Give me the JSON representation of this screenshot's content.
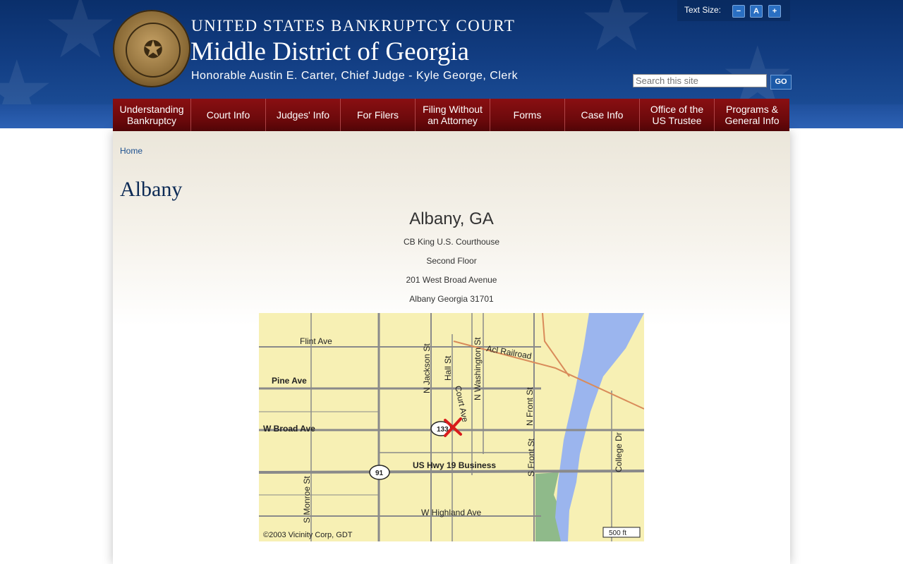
{
  "header": {
    "court_name": "UNITED STATES BANKRUPTCY COURT",
    "district": "Middle District of Georgia",
    "judges": "Honorable Austin E. Carter, Chief Judge - Kyle George, Clerk",
    "seal_icon": "seal-emblem"
  },
  "text_size": {
    "label": "Text Size:",
    "decrease": "−",
    "reset": "A",
    "increase": "+"
  },
  "search": {
    "placeholder": "Search this site",
    "go_label": "GO"
  },
  "nav": [
    "Understanding\nBankruptcy",
    "Court Info",
    "Judges' Info",
    "For Filers",
    "Filing Without\nan Attorney",
    "Forms",
    "Case Info",
    "Office of the\nUS Trustee",
    "Programs &\nGeneral Info"
  ],
  "breadcrumb": {
    "home": "Home"
  },
  "page": {
    "title": "Albany",
    "location_title": "Albany, GA",
    "address_lines": [
      "CB King U.S. Courthouse",
      "Second Floor",
      "201 West Broad Avenue",
      "Albany Georgia 31701"
    ]
  },
  "map": {
    "labels": {
      "flint": "Flint Ave",
      "pine": "Pine Ave",
      "broad": "W Broad Ave",
      "hwy19": "US Hwy 19 Business",
      "highland": "W Highland Ave",
      "jackson": "N Jackson St",
      "hall": "Hall St",
      "washington": "N Washington St",
      "railroad": "Acl Railroad",
      "court": "Court Ave",
      "nfront": "N Front St",
      "sfront": "S Front St",
      "college": "College Dr",
      "monroe": "S Monroe St",
      "route133": "133",
      "route91": "91",
      "copyright": "©2003 Vicinity Corp, GDT",
      "scale": "500 ft"
    },
    "colors": {
      "land": "#f7f0b4",
      "river": "#9bb5ee",
      "park": "#8fba8a",
      "road": "#8a8a8a",
      "rail": "#d98b5a",
      "marker": "#d81c1c"
    }
  }
}
